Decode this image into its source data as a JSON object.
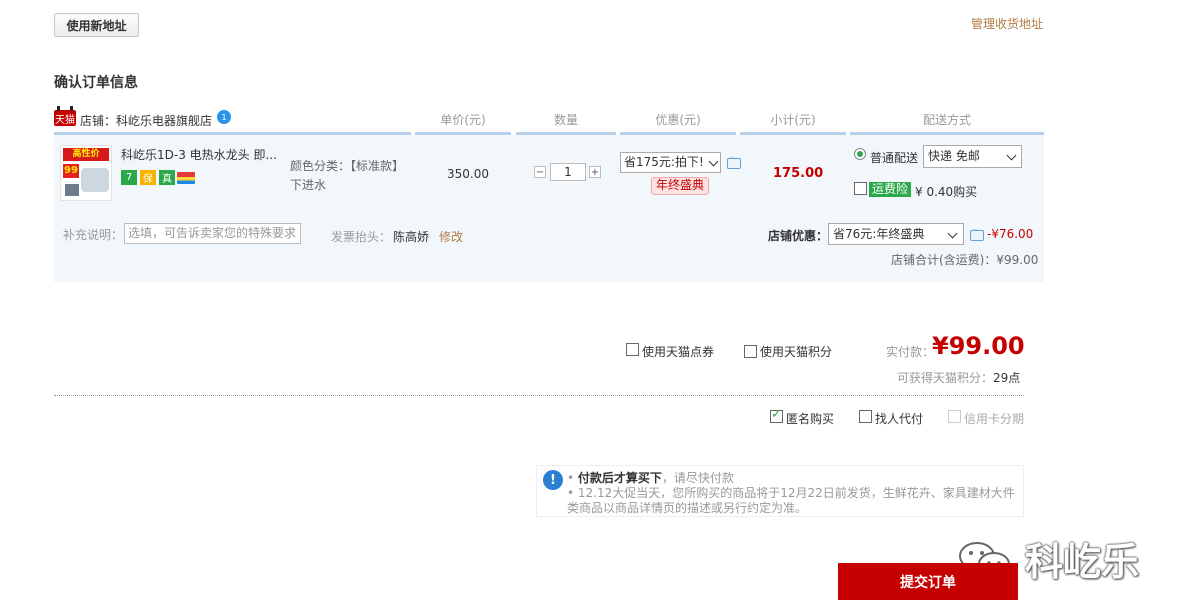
{
  "toolbar": {
    "new_address_label": "使用新地址",
    "manage_address_label": "管理收货地址"
  },
  "section_title": "确认订单信息",
  "shop": {
    "badge": "天猫",
    "label": "店铺：科屹乐电器旗舰店"
  },
  "columns": [
    "单价(元)",
    "数量",
    "优惠(元)",
    "小计(元)",
    "配送方式"
  ],
  "item": {
    "name": "科屹乐1D-3 电热水龙头 即...",
    "thumb_banner": "高性价",
    "thumb_price": "99",
    "service_icons": [
      "7",
      "保",
      "真"
    ],
    "sku_label": "颜色分类：【标准款】",
    "sku_value": "下进水",
    "price": "350.00",
    "quantity": "1",
    "qty_minus": "−",
    "qty_plus": "+",
    "promo_select": "省175元:拍下!",
    "promo_tag": "年终盛典",
    "subtotal": "175.00",
    "shipping_option": "普通配送",
    "shipping_select": "快递 免邮",
    "freight_insurance": "运费险",
    "freight_price": "¥ 0.40购买"
  },
  "extra": {
    "remark_label": "补充说明：",
    "remark_placeholder": "选填，可告诉卖家您的特殊要求",
    "invoice_label": "发票抬头：",
    "invoice_value": "陈高娇",
    "invoice_edit": "修改",
    "shop_discount_label": "店铺优惠：",
    "shop_discount_select": "省76元:年终盛典",
    "shop_discount_amount": "-¥76.00",
    "shop_total": "店铺合计(含运费)：¥99.00"
  },
  "payment": {
    "coupon_label": "使用天猫点券",
    "points_use_label": "使用天猫积分",
    "paid_label": "实付款：",
    "paid_amount": "¥99.00",
    "points_label": "可获得天猫积分：",
    "points_value": "29",
    "points_unit": "点"
  },
  "options": {
    "anonymous": "匿名购买",
    "proxy_pay": "找人代付",
    "installment": "信用卡分期"
  },
  "notice": {
    "title": "付款后才算买下",
    "title_suffix": "，请尽快付款",
    "text": "12.12大促当天，您所购买的商品将于12月22日前发货，生鲜花卉、家具建材大件类商品以商品详情页的描述或另行约定为准。"
  },
  "watermark": {
    "text": "科屹乐"
  },
  "submit_label": "提交订单",
  "colors": {
    "accent": "#c40000",
    "link": "#b27a44",
    "row_bg": "#f2f7fc",
    "header_line": "#b8d1ea"
  }
}
